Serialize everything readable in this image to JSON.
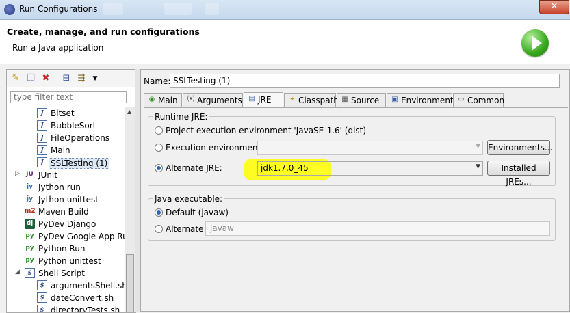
{
  "window": {
    "title": "Run Configurations",
    "close_glyph": "✕"
  },
  "header": {
    "title": "Create, manage, and run configurations",
    "subtitle": "Run a Java application"
  },
  "sidebar": {
    "filter_placeholder": "type filter text",
    "toolbar_icons": [
      "new-config-icon",
      "duplicate-icon",
      "delete-icon",
      "collapse-all-icon",
      "filter-icon",
      "dropdown-icon"
    ],
    "items": [
      {
        "label": "Bitset",
        "icon": "J",
        "depth": 2
      },
      {
        "label": "BubbleSort",
        "icon": "J",
        "depth": 2
      },
      {
        "label": "FileOperations",
        "icon": "J",
        "depth": 2
      },
      {
        "label": "Main",
        "icon": "J",
        "depth": 2
      },
      {
        "label": "SSLTesting (1)",
        "icon": "J",
        "depth": 2,
        "selected": true
      },
      {
        "label": "JUnit",
        "icon": "JU",
        "depth": 1,
        "expander": "▷"
      },
      {
        "label": "Jython run",
        "icon": "jy",
        "depth": 1
      },
      {
        "label": "Jython unittest",
        "icon": "jy",
        "depth": 1
      },
      {
        "label": "Maven Build",
        "icon": "m2",
        "depth": 1
      },
      {
        "label": "PyDev Django",
        "icon": "dj",
        "depth": 1
      },
      {
        "label": "PyDev Google App Run",
        "icon": "py",
        "depth": 1
      },
      {
        "label": "Python Run",
        "icon": "py",
        "depth": 1
      },
      {
        "label": "Python unittest",
        "icon": "py",
        "depth": 1
      },
      {
        "label": "Shell Script",
        "icon": "$",
        "depth": 1,
        "expander": "◢"
      },
      {
        "label": "argumentsShell.sh",
        "icon": "$",
        "depth": 2
      },
      {
        "label": "dateConvert.sh",
        "icon": "$",
        "depth": 2
      },
      {
        "label": "directoryTests.sh",
        "icon": "$",
        "depth": 2
      }
    ]
  },
  "config": {
    "name_label": "Name:",
    "name_value": "SSLTesting (1)",
    "tabs": [
      {
        "label": "Main",
        "icon": "main-tab-icon"
      },
      {
        "label": "Arguments",
        "icon": "arguments-tab-icon"
      },
      {
        "label": "JRE",
        "icon": "jre-tab-icon",
        "active": true
      },
      {
        "label": "Classpath",
        "icon": "classpath-tab-icon"
      },
      {
        "label": "Source",
        "icon": "source-tab-icon"
      },
      {
        "label": "Environment",
        "icon": "environment-tab-icon"
      },
      {
        "label": "Common",
        "icon": "common-tab-icon"
      }
    ],
    "runtime_jre": {
      "title": "Runtime JRE:",
      "option_project": "Project execution environment 'JavaSE-1.6' (dist)",
      "option_exec_env": "Execution environment:",
      "exec_env_value": "",
      "environments_button": "Environments...",
      "option_alternate": "Alternate JRE:",
      "alternate_value": "jdk1.7.0_45",
      "installed_jres_button": "Installed JREs...",
      "selected": "alternate"
    },
    "java_executable": {
      "title": "Java executable:",
      "option_default": "Default (javaw)",
      "option_alternate": "Alternate",
      "alternate_value": "javaw",
      "selected": "default"
    }
  },
  "colors": {
    "highlight": "#ffff00",
    "run_icon": "#38a81e",
    "radio_selected": "#2c63b7"
  }
}
